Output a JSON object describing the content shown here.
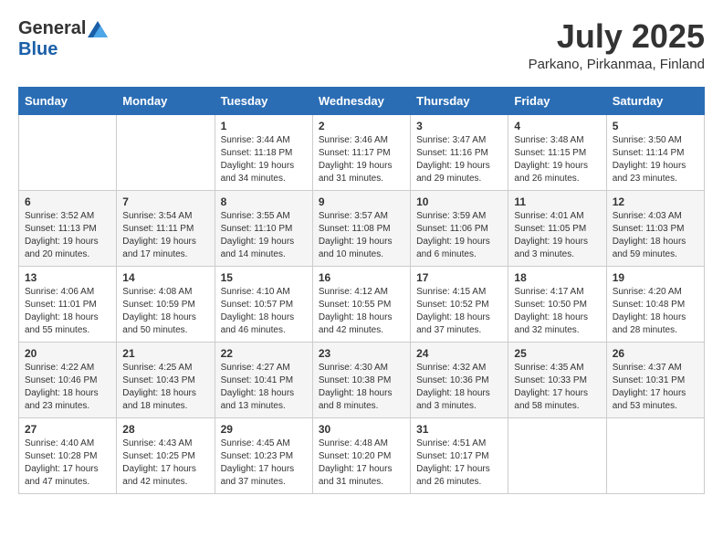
{
  "logo": {
    "general": "General",
    "blue": "Blue"
  },
  "title": {
    "month_year": "July 2025",
    "location": "Parkano, Pirkanmaa, Finland"
  },
  "days_of_week": [
    "Sunday",
    "Monday",
    "Tuesday",
    "Wednesday",
    "Thursday",
    "Friday",
    "Saturday"
  ],
  "weeks": [
    [
      {
        "day": "",
        "info": ""
      },
      {
        "day": "",
        "info": ""
      },
      {
        "day": "1",
        "info": "Sunrise: 3:44 AM\nSunset: 11:18 PM\nDaylight: 19 hours and 34 minutes."
      },
      {
        "day": "2",
        "info": "Sunrise: 3:46 AM\nSunset: 11:17 PM\nDaylight: 19 hours and 31 minutes."
      },
      {
        "day": "3",
        "info": "Sunrise: 3:47 AM\nSunset: 11:16 PM\nDaylight: 19 hours and 29 minutes."
      },
      {
        "day": "4",
        "info": "Sunrise: 3:48 AM\nSunset: 11:15 PM\nDaylight: 19 hours and 26 minutes."
      },
      {
        "day": "5",
        "info": "Sunrise: 3:50 AM\nSunset: 11:14 PM\nDaylight: 19 hours and 23 minutes."
      }
    ],
    [
      {
        "day": "6",
        "info": "Sunrise: 3:52 AM\nSunset: 11:13 PM\nDaylight: 19 hours and 20 minutes."
      },
      {
        "day": "7",
        "info": "Sunrise: 3:54 AM\nSunset: 11:11 PM\nDaylight: 19 hours and 17 minutes."
      },
      {
        "day": "8",
        "info": "Sunrise: 3:55 AM\nSunset: 11:10 PM\nDaylight: 19 hours and 14 minutes."
      },
      {
        "day": "9",
        "info": "Sunrise: 3:57 AM\nSunset: 11:08 PM\nDaylight: 19 hours and 10 minutes."
      },
      {
        "day": "10",
        "info": "Sunrise: 3:59 AM\nSunset: 11:06 PM\nDaylight: 19 hours and 6 minutes."
      },
      {
        "day": "11",
        "info": "Sunrise: 4:01 AM\nSunset: 11:05 PM\nDaylight: 19 hours and 3 minutes."
      },
      {
        "day": "12",
        "info": "Sunrise: 4:03 AM\nSunset: 11:03 PM\nDaylight: 18 hours and 59 minutes."
      }
    ],
    [
      {
        "day": "13",
        "info": "Sunrise: 4:06 AM\nSunset: 11:01 PM\nDaylight: 18 hours and 55 minutes."
      },
      {
        "day": "14",
        "info": "Sunrise: 4:08 AM\nSunset: 10:59 PM\nDaylight: 18 hours and 50 minutes."
      },
      {
        "day": "15",
        "info": "Sunrise: 4:10 AM\nSunset: 10:57 PM\nDaylight: 18 hours and 46 minutes."
      },
      {
        "day": "16",
        "info": "Sunrise: 4:12 AM\nSunset: 10:55 PM\nDaylight: 18 hours and 42 minutes."
      },
      {
        "day": "17",
        "info": "Sunrise: 4:15 AM\nSunset: 10:52 PM\nDaylight: 18 hours and 37 minutes."
      },
      {
        "day": "18",
        "info": "Sunrise: 4:17 AM\nSunset: 10:50 PM\nDaylight: 18 hours and 32 minutes."
      },
      {
        "day": "19",
        "info": "Sunrise: 4:20 AM\nSunset: 10:48 PM\nDaylight: 18 hours and 28 minutes."
      }
    ],
    [
      {
        "day": "20",
        "info": "Sunrise: 4:22 AM\nSunset: 10:46 PM\nDaylight: 18 hours and 23 minutes."
      },
      {
        "day": "21",
        "info": "Sunrise: 4:25 AM\nSunset: 10:43 PM\nDaylight: 18 hours and 18 minutes."
      },
      {
        "day": "22",
        "info": "Sunrise: 4:27 AM\nSunset: 10:41 PM\nDaylight: 18 hours and 13 minutes."
      },
      {
        "day": "23",
        "info": "Sunrise: 4:30 AM\nSunset: 10:38 PM\nDaylight: 18 hours and 8 minutes."
      },
      {
        "day": "24",
        "info": "Sunrise: 4:32 AM\nSunset: 10:36 PM\nDaylight: 18 hours and 3 minutes."
      },
      {
        "day": "25",
        "info": "Sunrise: 4:35 AM\nSunset: 10:33 PM\nDaylight: 17 hours and 58 minutes."
      },
      {
        "day": "26",
        "info": "Sunrise: 4:37 AM\nSunset: 10:31 PM\nDaylight: 17 hours and 53 minutes."
      }
    ],
    [
      {
        "day": "27",
        "info": "Sunrise: 4:40 AM\nSunset: 10:28 PM\nDaylight: 17 hours and 47 minutes."
      },
      {
        "day": "28",
        "info": "Sunrise: 4:43 AM\nSunset: 10:25 PM\nDaylight: 17 hours and 42 minutes."
      },
      {
        "day": "29",
        "info": "Sunrise: 4:45 AM\nSunset: 10:23 PM\nDaylight: 17 hours and 37 minutes."
      },
      {
        "day": "30",
        "info": "Sunrise: 4:48 AM\nSunset: 10:20 PM\nDaylight: 17 hours and 31 minutes."
      },
      {
        "day": "31",
        "info": "Sunrise: 4:51 AM\nSunset: 10:17 PM\nDaylight: 17 hours and 26 minutes."
      },
      {
        "day": "",
        "info": ""
      },
      {
        "day": "",
        "info": ""
      }
    ]
  ]
}
